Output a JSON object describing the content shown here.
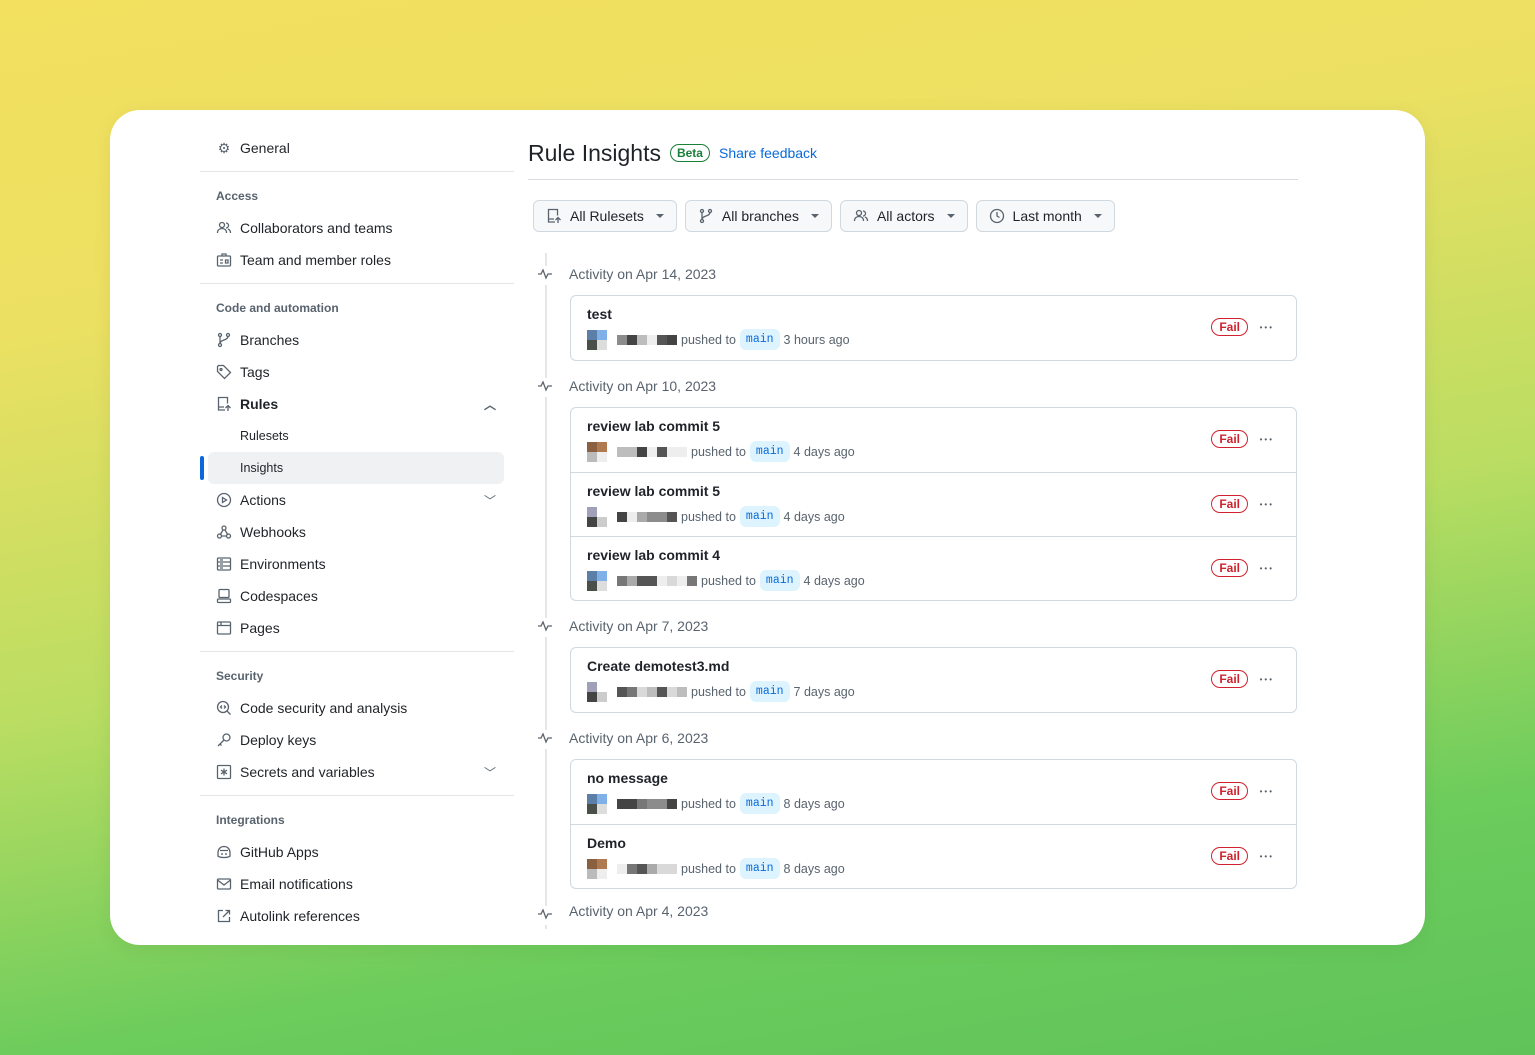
{
  "sidebar": {
    "general": "General",
    "access_header": "Access",
    "access": [
      "Collaborators and teams",
      "Team and member roles"
    ],
    "code_header": "Code and automation",
    "branches": "Branches",
    "tags": "Tags",
    "rules": "Rules",
    "rulesets": "Rulesets",
    "insights": "Insights",
    "actions": "Actions",
    "webhooks": "Webhooks",
    "environments": "Environments",
    "codespaces": "Codespaces",
    "pages": "Pages",
    "security_header": "Security",
    "security": [
      "Code security and analysis",
      "Deploy keys",
      "Secrets and variables"
    ],
    "integrations_header": "Integrations",
    "integrations": [
      "GitHub Apps",
      "Email notifications",
      "Autolink references"
    ]
  },
  "header": {
    "title": "Rule Insights",
    "badge": "Beta",
    "feedback": "Share feedback"
  },
  "filters": {
    "rulesets": "All Rulesets",
    "branches": "All branches",
    "actors": "All actors",
    "period": "Last month"
  },
  "colors": {
    "accent": "#0969da",
    "fail": "#cf222e",
    "beta": "#1a7f37"
  },
  "groups": [
    {
      "label": "Activity on Apr 14, 2023",
      "items": [
        {
          "title": "test",
          "action": "pushed to",
          "branch": "main",
          "time": "3 hours ago",
          "status": "Fail"
        }
      ]
    },
    {
      "label": "Activity on Apr 10, 2023",
      "items": [
        {
          "title": "review lab commit 5",
          "action": "pushed to",
          "branch": "main",
          "time": "4 days ago",
          "status": "Fail"
        },
        {
          "title": "review lab commit 5",
          "action": "pushed to",
          "branch": "main",
          "time": "4 days ago",
          "status": "Fail"
        },
        {
          "title": "review lab commit 4",
          "action": "pushed to",
          "branch": "main",
          "time": "4 days ago",
          "status": "Fail"
        }
      ]
    },
    {
      "label": "Activity on Apr 7, 2023",
      "items": [
        {
          "title": "Create demotest3.md",
          "action": "pushed to",
          "branch": "main",
          "time": "7 days ago",
          "status": "Fail"
        }
      ]
    },
    {
      "label": "Activity on Apr 6, 2023",
      "items": [
        {
          "title": "no message",
          "action": "pushed to",
          "branch": "main",
          "time": "8 days ago",
          "status": "Fail"
        },
        {
          "title": "Demo",
          "action": "pushed to",
          "branch": "main",
          "time": "8 days ago",
          "status": "Fail"
        }
      ]
    },
    {
      "label": "Activity on Apr 4, 2023",
      "items": []
    }
  ]
}
